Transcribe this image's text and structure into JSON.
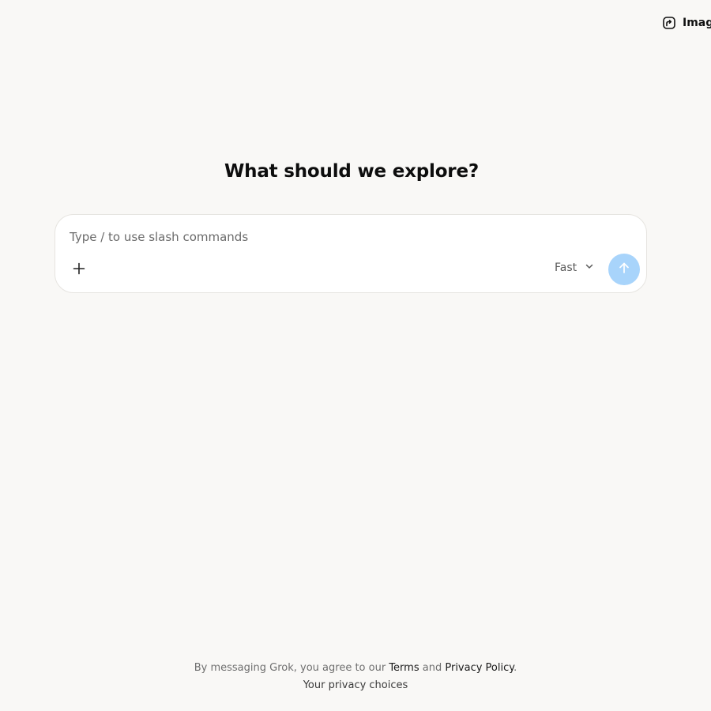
{
  "header": {
    "imagine_label": "Imagine",
    "imagine_icon": "imagine-icon"
  },
  "main": {
    "headline": "What should we explore?"
  },
  "composer": {
    "placeholder": "Type / to use slash commands",
    "attach_icon": "plus-icon",
    "model_label": "Fast",
    "model_icon": "chevron-down-icon",
    "send_icon": "arrow-up-icon",
    "send_color": "#a8d4fb"
  },
  "footer": {
    "agreement_prefix": "By messaging Grok, you agree to our",
    "terms_label": "Terms",
    "and_text": "and",
    "privacy_label": "Privacy Policy",
    "period": ".",
    "privacy_choices_label": "Your privacy choices"
  },
  "colors": {
    "background": "#f9f8f6",
    "card": "#ffffff",
    "border": "#e6e4e0"
  }
}
